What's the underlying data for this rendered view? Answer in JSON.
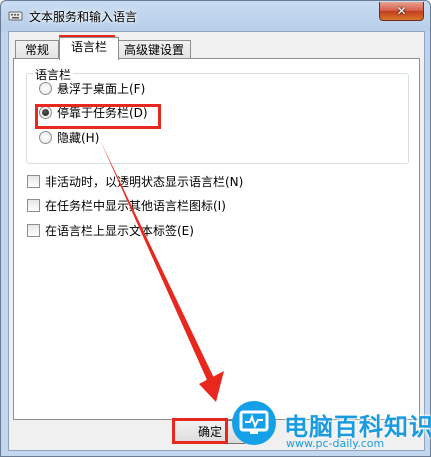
{
  "window": {
    "title": "文本服务和输入语言",
    "close_glyph": "✕"
  },
  "tabs": [
    {
      "label": "常规",
      "active": false
    },
    {
      "label": "语言栏",
      "active": true
    },
    {
      "label": "高级键设置",
      "active": false
    }
  ],
  "language_bar": {
    "group_label": "语言栏",
    "options": [
      {
        "label": "悬浮于桌面上(F)",
        "checked": false
      },
      {
        "label": "停靠于任务栏(D)",
        "checked": true
      },
      {
        "label": "隐藏(H)",
        "checked": false
      }
    ]
  },
  "checkboxes": [
    {
      "label": "非活动时，以透明状态显示语言栏(N)",
      "checked": false
    },
    {
      "label": "在任务栏中显示其他语言栏图标(I)",
      "checked": false
    },
    {
      "label": "在语言栏上显示文本标签(E)",
      "checked": false
    }
  ],
  "footer": {
    "ok_label": "确定"
  },
  "watermark": {
    "name": "电脑百科知识",
    "url": "www.pc-daily.com"
  },
  "colors": {
    "highlight": "#e8281f",
    "watermark": "#1a9be0"
  }
}
